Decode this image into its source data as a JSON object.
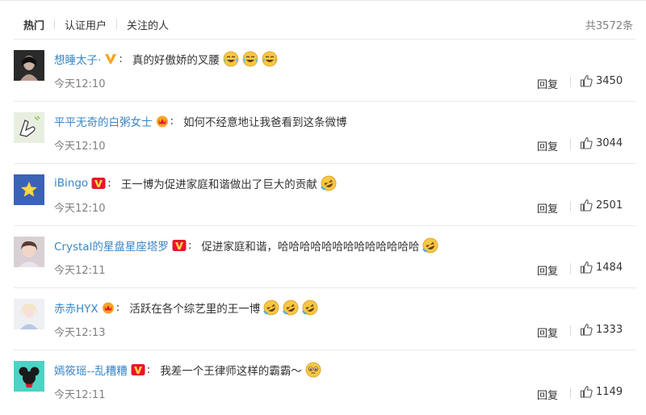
{
  "tabs": [
    {
      "label": "热门",
      "active": true
    },
    {
      "label": "认证用户",
      "active": false
    },
    {
      "label": "关注的人",
      "active": false
    }
  ],
  "total_count": "共3572条",
  "reply_label": "回复",
  "colors": {
    "username": "#3a86c6",
    "muted": "#808080",
    "text": "#333333",
    "divider": "#eaeaea",
    "vip_orange": "#f5a623",
    "verified_red": "#e6162d"
  },
  "comments": [
    {
      "username": "想睡太子·",
      "badge": "v-orange-icon",
      "text": "真的好傲娇的叉腰",
      "emojis": [
        "laugh-tears-icon",
        "laugh-tears-icon",
        "laugh-tears-icon"
      ],
      "time": "今天12:10",
      "likes": "3450"
    },
    {
      "username": "平平无奇的白粥女士",
      "badge": "crown-icon",
      "text": "如何不经意地让我爸看到这条微博",
      "emojis": [],
      "time": "今天12:10",
      "likes": "3044"
    },
    {
      "username": "iBingo",
      "badge": "v-red-icon",
      "text": "王一博为促进家庭和谐做出了巨大的贡献",
      "emojis": [
        "rolling-laugh-icon"
      ],
      "time": "今天12:10",
      "likes": "2501"
    },
    {
      "username": "Crystal的星盘星座塔罗",
      "badge": "v-red-icon",
      "text": "促进家庭和谐，哈哈哈哈哈哈哈哈哈哈哈哈哈",
      "emojis": [
        "rolling-laugh-icon"
      ],
      "time": "今天12:11",
      "likes": "1484"
    },
    {
      "username": "赤赤HYX",
      "badge": "crown-icon",
      "text": "活跃在各个综艺里的王一博",
      "emojis": [
        "rolling-laugh-icon",
        "rolling-laugh-icon",
        "rolling-laugh-icon"
      ],
      "time": "今天12:13",
      "likes": "1333"
    },
    {
      "username": "嫣筱瑶--乱糟糟",
      "badge": "v-red-icon",
      "text": "我差一个王律师这样的霸霸～",
      "emojis": [
        "pleading-face-icon"
      ],
      "time": "今天12:11",
      "likes": "1149"
    }
  ]
}
